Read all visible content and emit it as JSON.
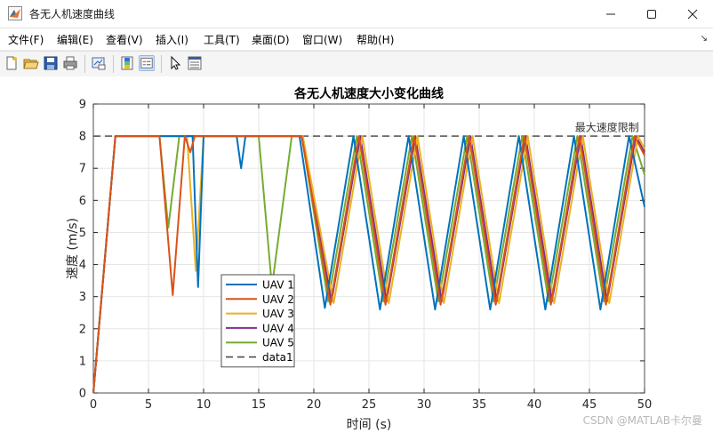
{
  "window": {
    "title": "各无人机速度曲线",
    "minimize_icon": "minimize-icon",
    "maximize_icon": "maximize-icon",
    "close_icon": "close-icon"
  },
  "menu": {
    "items": [
      "文件(F)",
      "编辑(E)",
      "查看(V)",
      "插入(I)",
      "工具(T)",
      "桌面(D)",
      "窗口(W)",
      "帮助(H)"
    ],
    "overflow_icon": "menu-arrow-icon"
  },
  "toolbar": {
    "icons": [
      "new-figure-icon",
      "open-file-icon",
      "save-icon",
      "print-icon",
      "link-figure-icon",
      "insert-colorbar-icon",
      "insert-legend-icon",
      "edit-plot-icon",
      "property-inspector-icon"
    ]
  },
  "watermark": "CSDN @MATLAB卡尔曼",
  "chart_data": {
    "type": "line",
    "title": "各无人机速度大小变化曲线",
    "xlabel": "时间 (s)",
    "ylabel": "速度 (m/s)",
    "xlim": [
      0,
      50
    ],
    "ylim": [
      0,
      9
    ],
    "xticks": [
      0,
      5,
      10,
      15,
      20,
      25,
      30,
      35,
      40,
      45,
      50
    ],
    "yticks": [
      0,
      1,
      2,
      3,
      4,
      5,
      6,
      7,
      8,
      9
    ],
    "grid": true,
    "legend_position": "lower-left",
    "colors": {
      "UAV 1": "#0072BD",
      "UAV 2": "#D95319",
      "UAV 3": "#EDB120",
      "UAV 4": "#7E2F8E",
      "UAV 5": "#77AC30",
      "data1": "#404040"
    },
    "series": [
      {
        "name": "UAV 1",
        "points": [
          [
            0,
            0
          ],
          [
            2,
            8
          ],
          [
            9,
            8
          ],
          [
            9.5,
            3.3
          ],
          [
            10,
            8
          ],
          [
            13,
            8
          ],
          [
            13.4,
            7
          ],
          [
            13.8,
            8
          ],
          [
            18,
            8
          ],
          [
            18.7,
            8
          ],
          [
            21,
            2.65
          ],
          [
            23.6,
            8
          ],
          [
            26,
            2.6
          ],
          [
            28.6,
            8
          ],
          [
            31,
            2.6
          ],
          [
            33.6,
            8
          ],
          [
            36,
            2.6
          ],
          [
            38.6,
            8
          ],
          [
            41,
            2.6
          ],
          [
            43.6,
            8
          ],
          [
            46,
            2.6
          ],
          [
            48.6,
            8
          ],
          [
            50,
            5.8
          ]
        ]
      },
      {
        "name": "UAV 2",
        "points": [
          [
            0,
            0
          ],
          [
            2,
            8
          ],
          [
            6,
            8
          ],
          [
            7.2,
            3.05
          ],
          [
            8.3,
            8
          ],
          [
            8.8,
            7.5
          ],
          [
            9.2,
            8
          ],
          [
            18.9,
            8
          ],
          [
            21.5,
            2.75
          ],
          [
            24.1,
            8
          ],
          [
            26.5,
            2.75
          ],
          [
            29.1,
            8
          ],
          [
            31.5,
            2.75
          ],
          [
            34.1,
            8
          ],
          [
            36.5,
            2.75
          ],
          [
            39.1,
            8
          ],
          [
            41.5,
            2.75
          ],
          [
            44.1,
            8
          ],
          [
            46.5,
            2.75
          ],
          [
            49.1,
            8
          ],
          [
            50,
            7.4
          ]
        ]
      },
      {
        "name": "UAV 3",
        "points": [
          [
            0,
            0
          ],
          [
            2,
            8
          ],
          [
            8.5,
            8
          ],
          [
            9.3,
            3.8
          ],
          [
            10,
            8
          ],
          [
            19,
            8
          ],
          [
            21.8,
            2.8
          ],
          [
            24.4,
            8
          ],
          [
            26.8,
            2.8
          ],
          [
            29.4,
            8
          ],
          [
            31.8,
            2.8
          ],
          [
            34.4,
            8
          ],
          [
            36.8,
            2.8
          ],
          [
            39.4,
            8
          ],
          [
            41.8,
            2.8
          ],
          [
            44.4,
            8
          ],
          [
            46.8,
            2.8
          ],
          [
            49.4,
            8
          ],
          [
            50,
            7.6
          ]
        ]
      },
      {
        "name": "UAV 4",
        "points": [
          [
            0,
            0
          ],
          [
            2,
            8
          ],
          [
            18.9,
            8
          ],
          [
            21.6,
            2.85
          ],
          [
            24.2,
            8
          ],
          [
            26.6,
            2.85
          ],
          [
            29.2,
            8
          ],
          [
            31.6,
            2.85
          ],
          [
            34.2,
            8
          ],
          [
            36.6,
            2.85
          ],
          [
            39.2,
            8
          ],
          [
            41.6,
            2.85
          ],
          [
            44.2,
            8
          ],
          [
            46.6,
            2.85
          ],
          [
            49.2,
            8
          ],
          [
            50,
            7.5
          ]
        ]
      },
      {
        "name": "UAV 5",
        "points": [
          [
            0,
            0
          ],
          [
            2,
            8
          ],
          [
            6,
            8
          ],
          [
            6.8,
            5.15
          ],
          [
            7.8,
            8
          ],
          [
            15,
            8
          ],
          [
            16.2,
            3.3
          ],
          [
            18,
            8
          ],
          [
            18.9,
            8
          ],
          [
            21.3,
            2.85
          ],
          [
            23.9,
            8
          ],
          [
            26.3,
            2.85
          ],
          [
            28.9,
            8
          ],
          [
            31.3,
            2.85
          ],
          [
            33.9,
            8
          ],
          [
            36.3,
            2.85
          ],
          [
            38.9,
            8
          ],
          [
            41.3,
            2.85
          ],
          [
            43.9,
            8
          ],
          [
            46.3,
            2.85
          ],
          [
            48.9,
            8
          ],
          [
            50,
            6.8
          ]
        ]
      },
      {
        "name": "data1",
        "points": [
          [
            0,
            8
          ],
          [
            50,
            8
          ]
        ],
        "dashed": true
      }
    ],
    "annotations": [
      {
        "text": "最大速度限制",
        "x": 49.5,
        "y": 8.15
      }
    ]
  }
}
